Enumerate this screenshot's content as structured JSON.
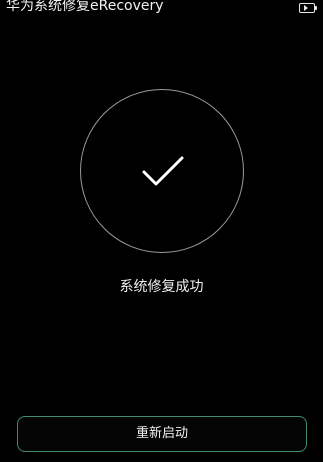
{
  "status_bar": {
    "title": "华为系统修复eRecovery",
    "battery_icon": "battery-charging-icon"
  },
  "result": {
    "icon": "checkmark-icon",
    "message": "系统修复成功"
  },
  "actions": {
    "reboot_label": "重新启动"
  },
  "colors": {
    "background": "#000000",
    "ring": "#9a9a9a",
    "button_border": "#3e8a76",
    "text": "#f0f0f0"
  }
}
